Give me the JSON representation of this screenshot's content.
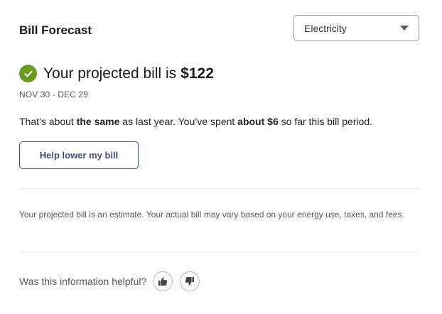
{
  "header": {
    "title": "Bill Forecast"
  },
  "utility_select": {
    "selected": "Electricity"
  },
  "forecast": {
    "headline_prefix": "Your projected bill is",
    "amount": "$122",
    "date_range": "NOV 30 - DEC 29",
    "summary_part1": "That’s about ",
    "summary_bold1": "the same",
    "summary_part2": " as last year. You’ve spent ",
    "summary_bold2": "about $6",
    "summary_part3": " so far this bill period.",
    "status_color": "#6a9a1f"
  },
  "actions": {
    "help_label": "Help lower my bill"
  },
  "disclaimer": "Your projected bill is an estimate. Your actual bill may vary based on your energy use, taxes, and fees.",
  "feedback": {
    "question": "Was this information helpful?",
    "thumbs_up_icon": "thumbs-up-icon",
    "thumbs_down_icon": "thumbs-down-icon"
  },
  "colors": {
    "accent": "#3d4f7a",
    "success": "#6a9a1f"
  }
}
